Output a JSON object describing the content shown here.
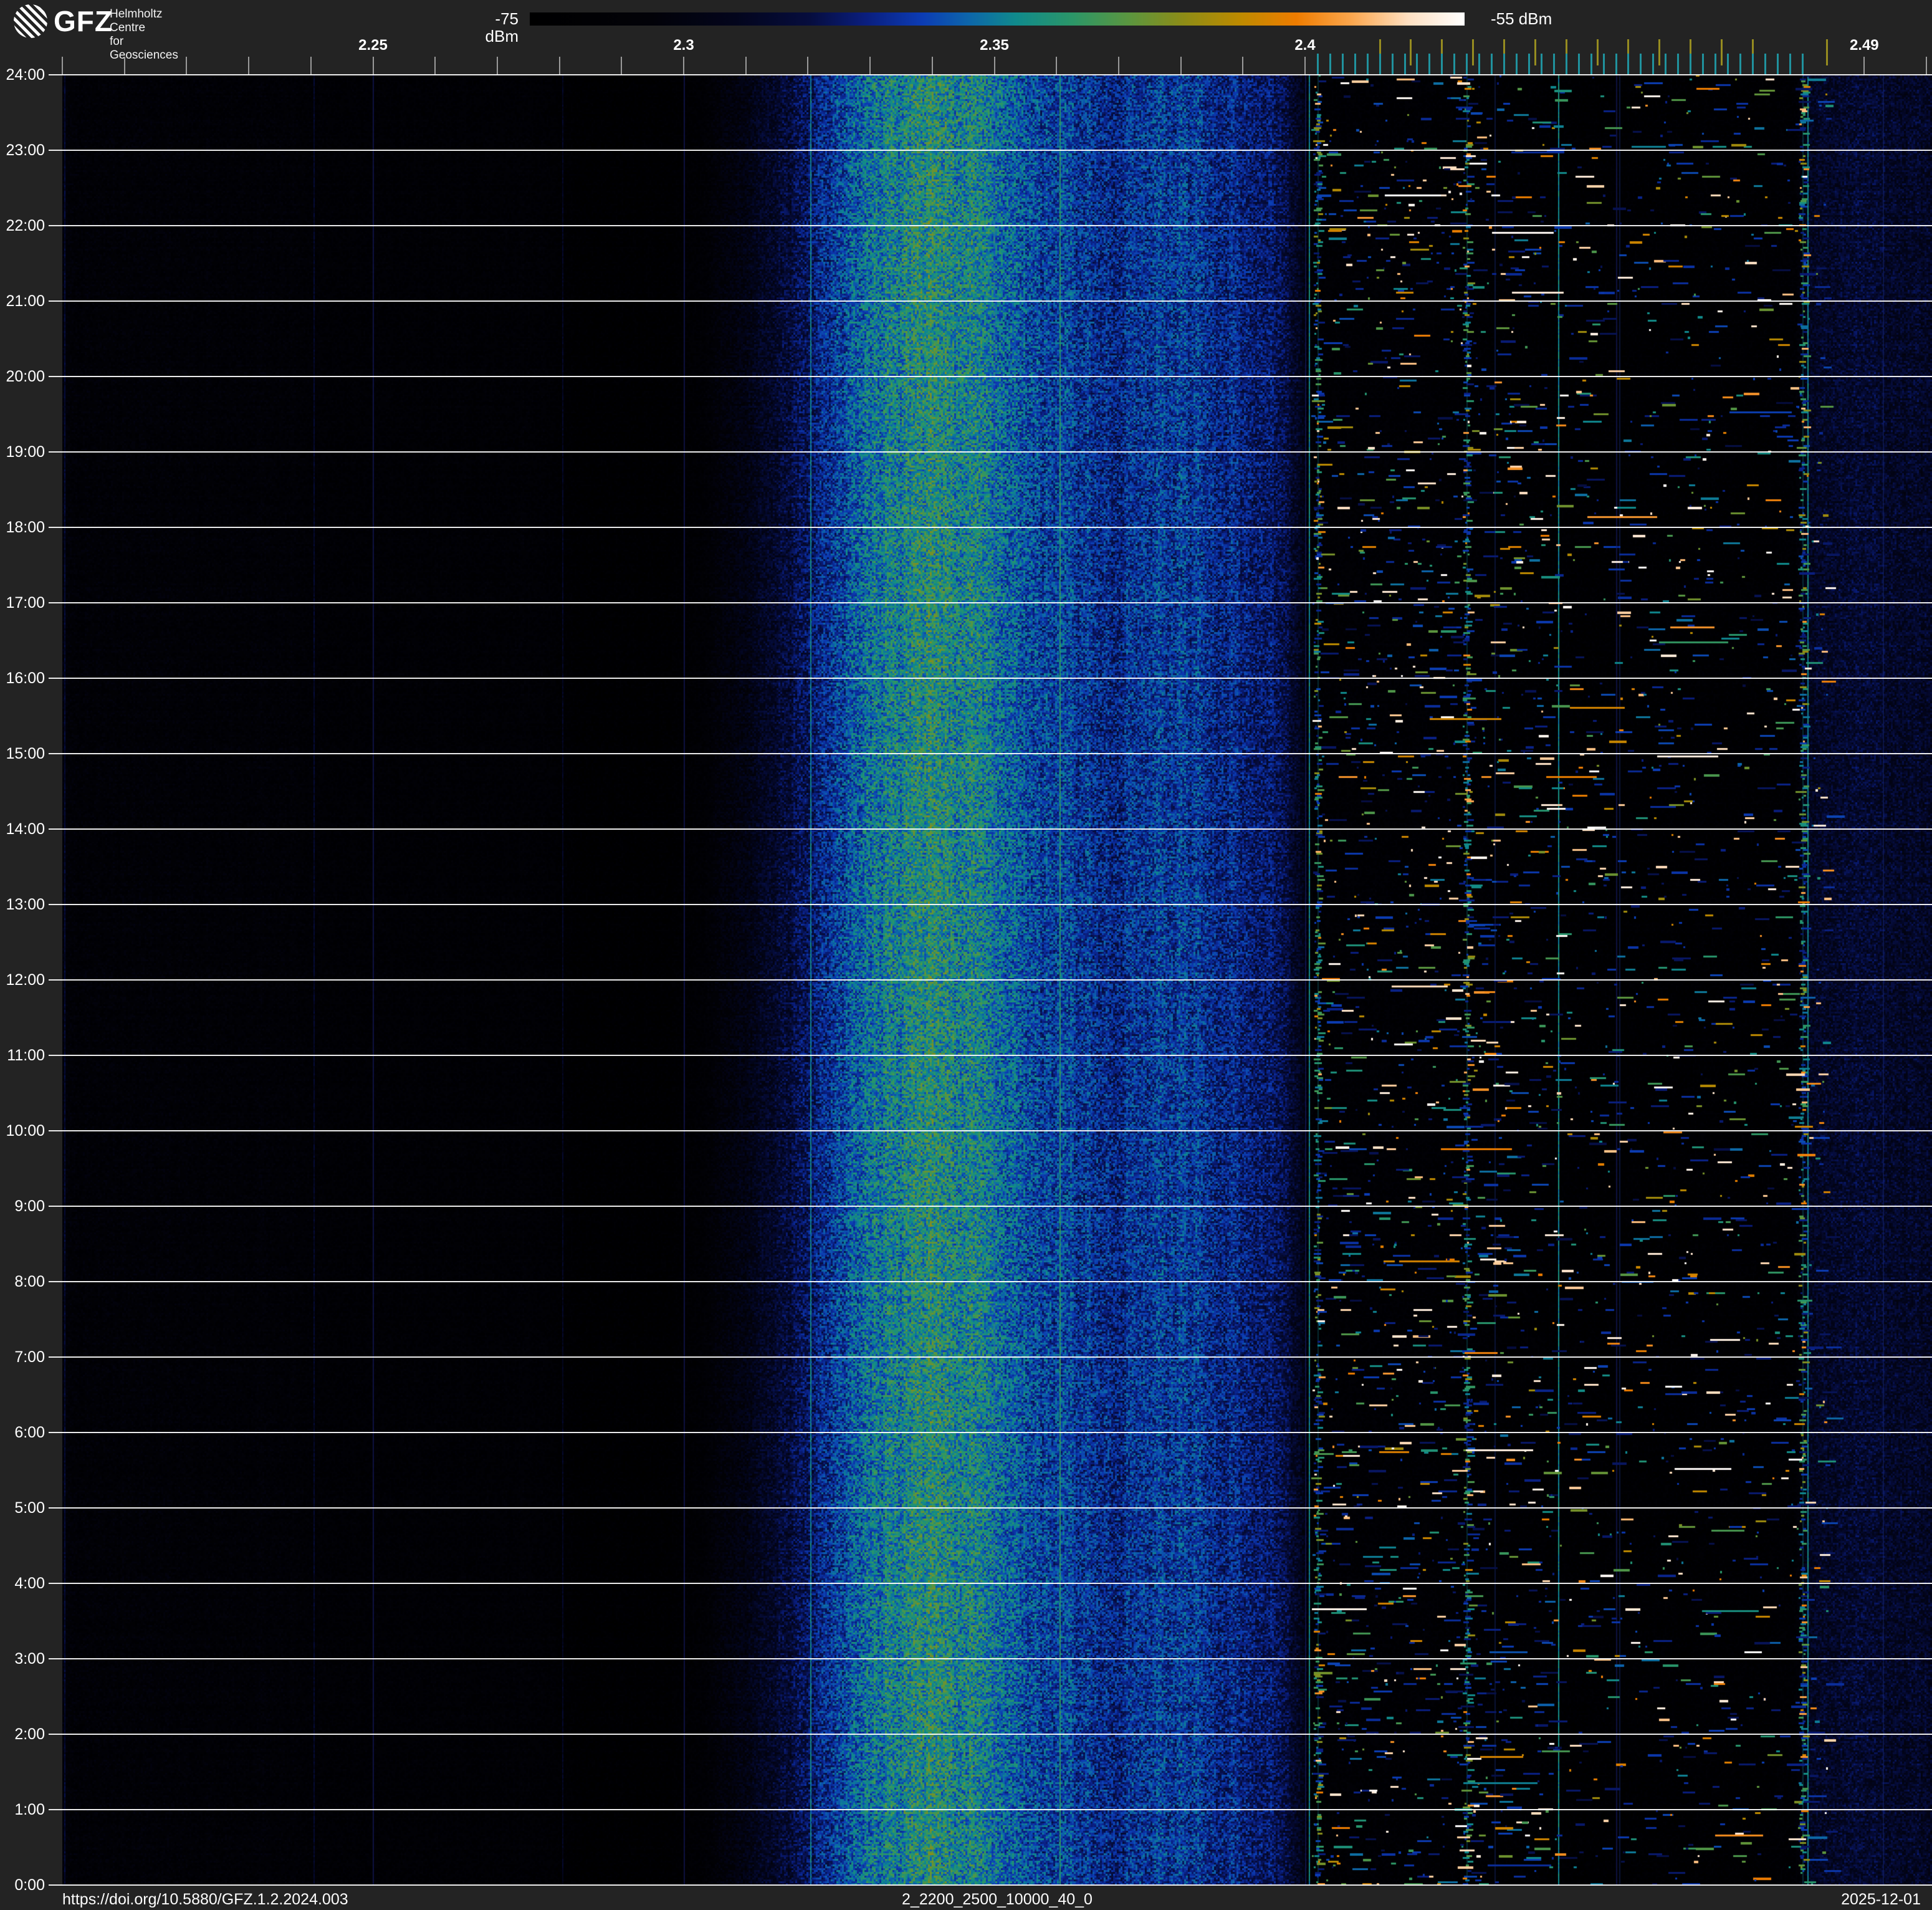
{
  "header": {
    "logo": {
      "acronym": "GFZ",
      "tagline_line1": "Helmholtz Centre",
      "tagline_line2": "for Geosciences"
    },
    "colorbar": {
      "min_label": "-75 dBm",
      "max_label": "-55 dBm"
    }
  },
  "footer": {
    "doi": "https://doi.org/10.5880/GFZ.1.2.2024.003",
    "filename": "2_2200_2500_10000_40_0",
    "date": "2025-12-01"
  },
  "chart_data": {
    "type": "heatmap",
    "subtype": "rf-spectrogram-waterfall",
    "title": "2_2200_2500_10000_40_0",
    "date": "2025-12-01",
    "power_range_dbm": [
      -75,
      -55
    ],
    "x_axis": {
      "quantity": "frequency",
      "unit": "GHz",
      "min_ghz": 2.2,
      "max_ghz": 2.5,
      "minor_tick_step_ghz": 0.01,
      "labels": [
        {
          "text": "2.25",
          "ghz": 2.25
        },
        {
          "text": "2.3",
          "ghz": 2.3
        },
        {
          "text": "2.35",
          "ghz": 2.35
        },
        {
          "text": "2.4",
          "ghz": 2.4
        },
        {
          "text": "2.49",
          "ghz": 2.49
        }
      ],
      "minor_tick_color": "#9a9a9a",
      "wifi_channel_ticks_ghz": [
        2.412,
        2.417,
        2.422,
        2.427,
        2.432,
        2.437,
        2.442,
        2.447,
        2.452,
        2.457,
        2.462,
        2.467,
        2.472,
        2.484
      ],
      "wifi_tick_color": "#968c20",
      "ble_channel_ticks": {
        "start_ghz": 2.402,
        "step_ghz": 0.002,
        "count": 40
      },
      "ble_tick_color": "#20929e"
    },
    "y_axis": {
      "quantity": "time-of-day",
      "top_to_bottom": true,
      "labels": [
        "24:00",
        "23:00",
        "22:00",
        "21:00",
        "20:00",
        "19:00",
        "18:00",
        "17:00",
        "16:00",
        "15:00",
        "14:00",
        "13:00",
        "12:00",
        "11:00",
        "10:00",
        "9:00",
        "8:00",
        "7:00",
        "6:00",
        "5:00",
        "4:00",
        "3:00",
        "2:00",
        "1:00",
        "0:00"
      ]
    },
    "colormap_stops": [
      [
        0.0,
        "#000000"
      ],
      [
        0.13,
        "#020208"
      ],
      [
        0.22,
        "#03051c"
      ],
      [
        0.3,
        "#060d3e"
      ],
      [
        0.36,
        "#0a1e7e"
      ],
      [
        0.42,
        "#0c3cb4"
      ],
      [
        0.47,
        "#0d66aa"
      ],
      [
        0.52,
        "#108a8c"
      ],
      [
        0.58,
        "#2b9668"
      ],
      [
        0.64,
        "#5a9640"
      ],
      [
        0.7,
        "#8e8c16"
      ],
      [
        0.76,
        "#bd8a00"
      ],
      [
        0.82,
        "#ee7c00"
      ],
      [
        0.88,
        "#fba74f"
      ],
      [
        0.94,
        "#fee0c2"
      ],
      [
        1.0,
        "#ffffff"
      ]
    ],
    "band_profile": [
      [
        2.2,
        0.105
      ],
      [
        2.236,
        0.095
      ],
      [
        2.243,
        0.085
      ],
      [
        2.278,
        0.08
      ],
      [
        2.283,
        0.042
      ],
      [
        2.298,
        0.042
      ],
      [
        2.303,
        0.085
      ],
      [
        2.31,
        0.18
      ],
      [
        2.318,
        0.3
      ],
      [
        2.326,
        0.43
      ],
      [
        2.332,
        0.51
      ],
      [
        2.337,
        0.545
      ],
      [
        2.345,
        0.545
      ],
      [
        2.35,
        0.49
      ],
      [
        2.356,
        0.43
      ],
      [
        2.362,
        0.405
      ],
      [
        2.369,
        0.39
      ],
      [
        2.374,
        0.395
      ],
      [
        2.379,
        0.415
      ],
      [
        2.384,
        0.39
      ],
      [
        2.39,
        0.355
      ],
      [
        2.396,
        0.32
      ],
      [
        2.3995,
        0.2
      ],
      [
        2.4005,
        0.1
      ],
      [
        2.402,
        0.07
      ],
      [
        2.412,
        0.072
      ],
      [
        2.424,
        0.062
      ],
      [
        2.432,
        0.055
      ],
      [
        2.442,
        0.047
      ],
      [
        2.452,
        0.047
      ],
      [
        2.464,
        0.05
      ],
      [
        2.474,
        0.052
      ],
      [
        2.479,
        0.075
      ],
      [
        2.4815,
        0.23
      ],
      [
        2.488,
        0.26
      ],
      [
        2.494,
        0.25
      ],
      [
        2.5008,
        0.24
      ]
    ],
    "spur_lines_ghz": [
      2.2003,
      2.2404,
      2.2804,
      2.3204,
      2.3605,
      2.4006,
      2.4407,
      2.4808
    ],
    "ble_advertising_columns_ghz": [
      2.402,
      2.426,
      2.48
    ],
    "activity_region_ghz": [
      2.401,
      2.484
    ],
    "faint_lines_ghz": [
      2.4305,
      2.4506,
      2.493
    ],
    "vertical_gridlines_ghz": [
      2.25,
      2.3,
      2.35,
      2.4,
      2.45
    ],
    "grid": {
      "hour_line_color": "#ffffff",
      "vertical_grid_color": "rgba(45,60,220,0.28)"
    }
  }
}
